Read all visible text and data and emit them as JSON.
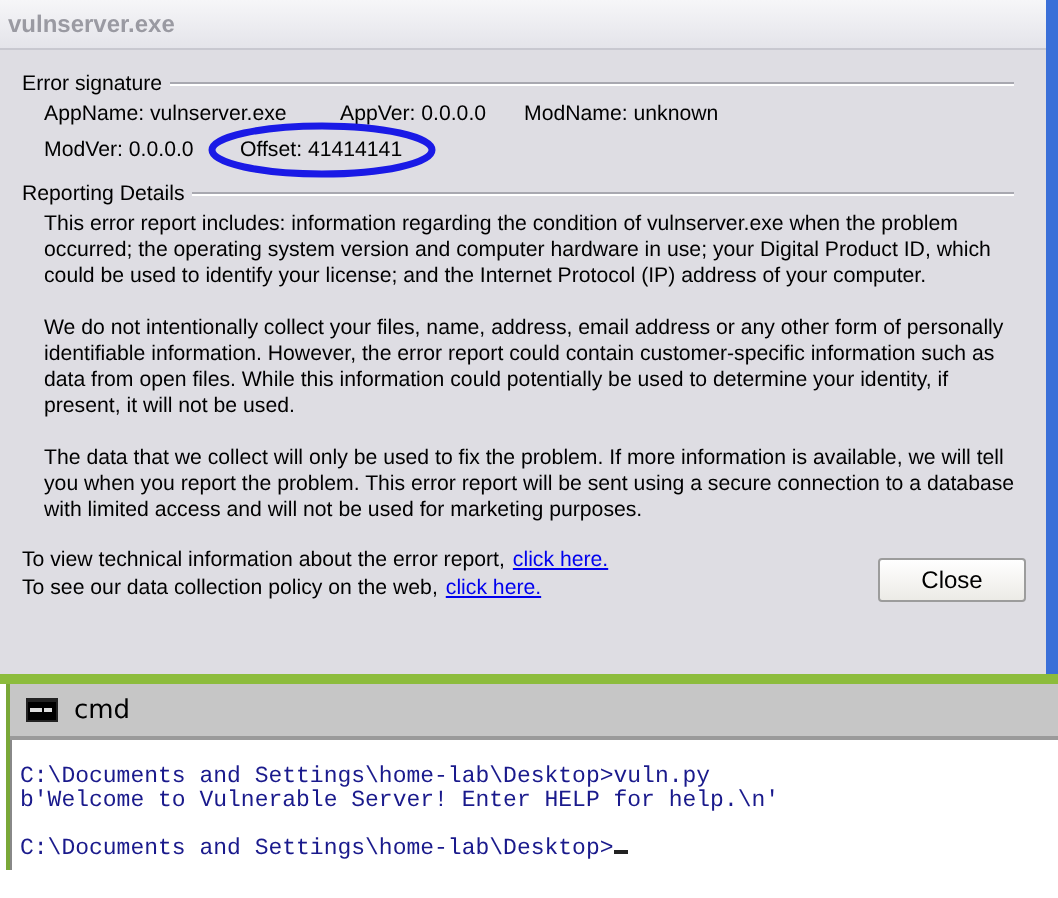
{
  "window": {
    "title": "vulnserver.exe"
  },
  "error_signature": {
    "heading": "Error signature",
    "rows": [
      [
        "AppName: vulnserver.exe",
        "AppVer: 0.0.0.0",
        "ModName: unknown"
      ],
      [
        "ModVer: 0.0.0.0",
        "Offset: 41414141"
      ]
    ]
  },
  "reporting_details": {
    "heading": "Reporting Details",
    "paragraphs": [
      "This error report includes: information regarding the condition of vulnserver.exe when the problem occurred; the operating system version and computer hardware in use; your Digital Product ID, which could be used to identify your license; and the Internet Protocol (IP) address of your computer.",
      "We do not intentionally collect your files, name, address, email address or any other form of personally identifiable information. However, the error report could contain customer-specific information such as data from open files. While this information could potentially be used to determine your identity, if present, it will not be used.",
      "The data that we collect will only be used to fix the problem. If more information is available, we will tell you when you report the problem. This error report will be sent using a secure connection to a database with limited access and will not be used for marketing purposes."
    ]
  },
  "links": [
    {
      "text": "To view technical information about the error report,",
      "link": "click here."
    },
    {
      "text": "To see our data collection policy on the web,",
      "link": "click here."
    }
  ],
  "buttons": [
    "Close"
  ],
  "console": {
    "title": "cmd",
    "blocks": [
      [
        "C:\\Documents and Settings\\home-lab\\Desktop>vuln.py",
        "b'Welcome to Vulnerable Server! Enter HELP for help.\\n'"
      ],
      [
        "C:\\Documents and Settings\\home-lab\\Desktop>"
      ]
    ]
  }
}
